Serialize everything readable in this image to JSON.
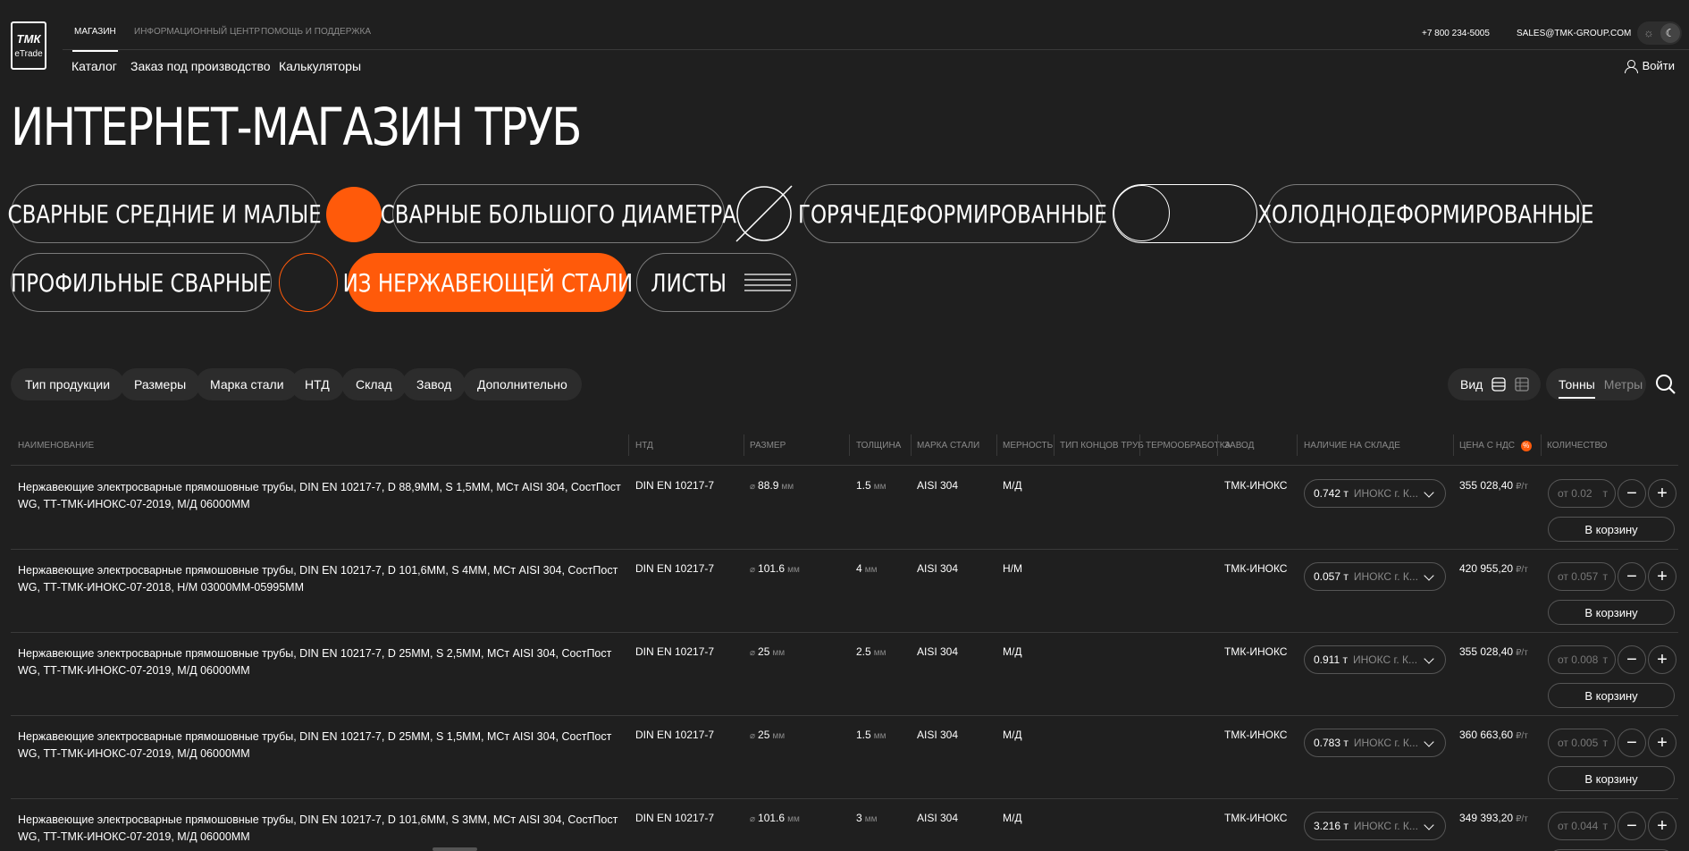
{
  "logo": {
    "mark": "ТМК",
    "sub": "eTrade"
  },
  "topnav": {
    "tabs": [
      "МАГАЗИН",
      "ИНФОРМАЦИОННЫЙ ЦЕНТР",
      "ПОМОЩЬ И ПОДДЕРЖКА"
    ],
    "phone": "+7 800 234-5005",
    "email": "SALES@TMK-GROUP.COM"
  },
  "subnav": [
    "Каталог",
    "Заказ под производство",
    "Калькуляторы"
  ],
  "login_label": "Войти",
  "page_title": "ИНТЕРНЕТ-МАГАЗИН ТРУБ",
  "categories": [
    "СВАРНЫЕ СРЕДНИЕ И МАЛЫЕ",
    "СВАРНЫЕ БОЛЬШОГО ДИАМЕТРА",
    "ГОРЯЧЕДЕФОРМИРОВАННЫЕ",
    "ХОЛОДНОДЕФОРМИРОВАННЫЕ",
    "ПРОФИЛЬНЫЕ СВАРНЫЕ",
    "ИЗ НЕРЖАВЕЮЩЕЙ СТАЛИ",
    "ЛИСТЫ"
  ],
  "accent_color": "#ff5a0a",
  "filters": [
    "Тип продукции",
    "Размеры",
    "Марка стали",
    "НТД",
    "Склад",
    "Завод",
    "Дополнительно"
  ],
  "view": {
    "label": "Вид",
    "units": [
      "Тонны",
      "Метры"
    ],
    "active_unit": "Тонны"
  },
  "table": {
    "headers": [
      "НАИМЕНОВАНИЕ",
      "НТД",
      "РАЗМЕР",
      "ТОЛЩИНА",
      "МАРКА СТАЛИ",
      "МЕРНОСТЬ",
      "ТИП КОНЦОВ ТРУБ",
      "ТЕРМООБРАБОТКА",
      "ЗАВОД",
      "НАЛИЧИЕ НА СКЛАДЕ",
      "ЦЕНА С НДС",
      "КОЛИЧЕСТВО"
    ],
    "size_prefix": "⌀",
    "mm": "мм",
    "price_unit": "₽/т",
    "cart_label": "В корзину",
    "ton_unit": "т",
    "rows": [
      {
        "name": "Нержавеющие электросварные прямошовные трубы, DIN EN 10217-7, D 88,9ММ, S 1,5ММ, МСт AISI 304, СостПост WG, ТТ-ТМК-ИНОКС-07-2019, М/Д 06000ММ",
        "ntd": "DIN EN 10217-7",
        "size": "88.9",
        "thickness": "1.5",
        "steel": "AISI 304",
        "mernost": "М/Д",
        "plant": "ТМК-ИНОКС",
        "stock": "0.742 т",
        "warehouse": "ИНОКС г. К...",
        "price": "355 028,40",
        "qty_placeholder": "от 0.02"
      },
      {
        "name": "Нержавеющие электросварные прямошовные трубы, DIN EN 10217-7, D 101,6ММ, S 4ММ, МСт AISI 304, СостПост WG, ТТ-ТМК-ИНОКС-07-2018, Н/М 03000ММ-05995ММ",
        "ntd": "DIN EN 10217-7",
        "size": "101.6",
        "thickness": "4",
        "steel": "AISI 304",
        "mernost": "Н/М",
        "plant": "ТМК-ИНОКС",
        "stock": "0.057 т",
        "warehouse": "ИНОКС г. К...",
        "price": "420 955,20",
        "qty_placeholder": "от 0.057"
      },
      {
        "name": "Нержавеющие электросварные прямошовные трубы, DIN EN 10217-7, D 25ММ, S 2,5ММ, МСт AISI 304, СостПост WG, ТТ-ТМК-ИНОКС-07-2019, М/Д 06000ММ",
        "ntd": "DIN EN 10217-7",
        "size": "25",
        "thickness": "2.5",
        "steel": "AISI 304",
        "mernost": "М/Д",
        "plant": "ТМК-ИНОКС",
        "stock": "0.911 т",
        "warehouse": "ИНОКС г. К...",
        "price": "355 028,40",
        "qty_placeholder": "от 0.008"
      },
      {
        "name": "Нержавеющие электросварные прямошовные трубы, DIN EN 10217-7, D 25ММ, S 1,5ММ, МСт AISI 304, СостПост WG, ТТ-ТМК-ИНОКС-07-2019, М/Д 06000ММ",
        "ntd": "DIN EN 10217-7",
        "size": "25",
        "thickness": "1.5",
        "steel": "AISI 304",
        "mernost": "М/Д",
        "plant": "ТМК-ИНОКС",
        "stock": "0.783 т",
        "warehouse": "ИНОКС г. К...",
        "price": "360 663,60",
        "qty_placeholder": "от 0.005"
      },
      {
        "name": "Нержавеющие электросварные прямошовные трубы, DIN EN 10217-7, D 101,6ММ, S 3ММ, МСт AISI 304, СостПост WG, ТТ-ТМК-ИНОКС-07-2019, М/Д 06000ММ",
        "ntd": "DIN EN 10217-7",
        "size": "101.6",
        "thickness": "3",
        "steel": "AISI 304",
        "mernost": "М/Д",
        "plant": "ТМК-ИНОКС",
        "stock": "3.216 т",
        "warehouse": "ИНОКС г. К...",
        "price": "349 393,20",
        "qty_placeholder": "от 0.044"
      }
    ]
  }
}
